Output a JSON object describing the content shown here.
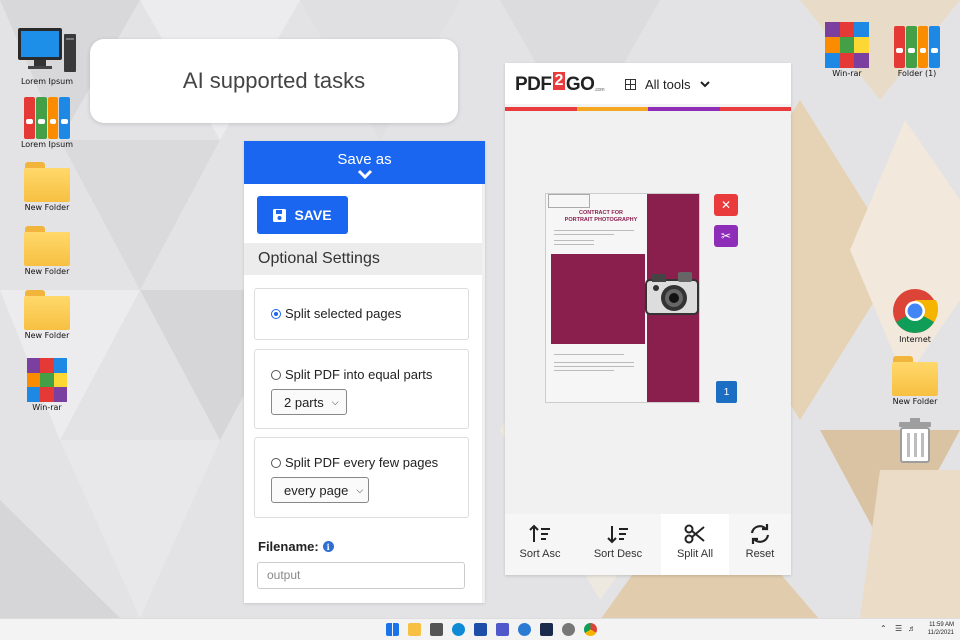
{
  "desktop": {
    "left_icons": [
      {
        "label": "Lorem Ipsum",
        "icon": "computer-icon"
      },
      {
        "label": "Lorem Ipsum",
        "icon": "binders-icon"
      },
      {
        "label": "New Folder",
        "icon": "folder-icon"
      },
      {
        "label": "New Folder",
        "icon": "folder-icon"
      },
      {
        "label": "New Folder",
        "icon": "folder-icon"
      },
      {
        "label": "Win-rar",
        "icon": "winrar-icon"
      }
    ],
    "right_icons": [
      {
        "label": "Win-rar",
        "icon": "winrar-icon"
      },
      {
        "label": "Folder (1)",
        "icon": "binders-icon"
      },
      {
        "label": "Internet",
        "icon": "chrome-icon"
      },
      {
        "label": "New Folder",
        "icon": "folder-icon"
      },
      {
        "label": "",
        "icon": "trash-icon"
      }
    ]
  },
  "tasks_card": {
    "text": "AI supported tasks"
  },
  "save_panel": {
    "header": "Save as",
    "save_button": "SAVE",
    "optional_settings": "Optional Settings",
    "options": [
      {
        "label": "Split selected pages",
        "selected": true
      },
      {
        "label": "Split PDF into equal parts",
        "selected": false,
        "select_value": "2 parts"
      },
      {
        "label": "Split PDF every few pages",
        "selected": false,
        "select_value": "every page"
      }
    ],
    "filename_label": "Filename:",
    "filename_placeholder": "output"
  },
  "pdf2go": {
    "logo_left": "PDF",
    "logo_mid": "2",
    "logo_right": "GO",
    "logo_suffix": ".com",
    "all_tools": "All tools",
    "page_number": "1",
    "doc_title_line1": "CONTRACT FOR",
    "doc_title_line2": "PORTRAIT PHOTOGRAPHY",
    "bottom_buttons": [
      "Sort Asc",
      "Sort Desc",
      "Split All",
      "Reset"
    ],
    "colors": {
      "accent_red": "#e93b3b",
      "accent_purple": "#8e2db8",
      "page_blue": "#1b6ec2"
    }
  },
  "taskbar": {
    "time": "11:59 AM",
    "date": "11/2/2021"
  },
  "colors": {
    "primary_blue": "#1a66f0",
    "doc_band": "#8a1e4c"
  }
}
